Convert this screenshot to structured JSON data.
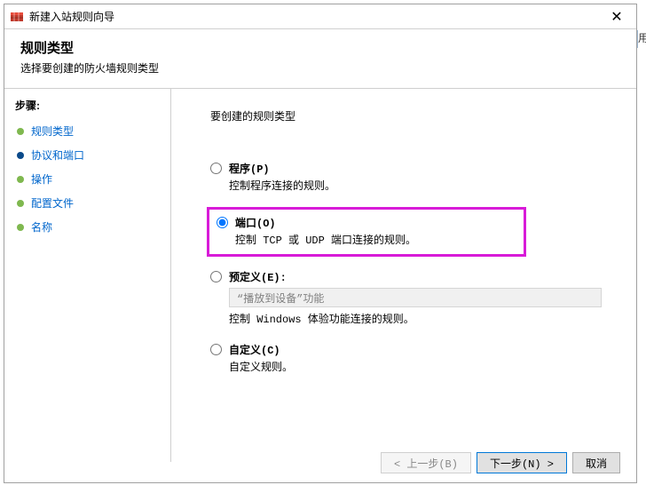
{
  "titlebar": {
    "title": "新建入站规则向导"
  },
  "header": {
    "title": "规则类型",
    "subtitle": "选择要创建的防火墙规则类型"
  },
  "sidebar": {
    "heading": "步骤:",
    "items": [
      {
        "label": "规则类型",
        "active": false,
        "link": true,
        "bullet": "green"
      },
      {
        "label": "协议和端口",
        "active": true,
        "link": true,
        "bullet": "blue"
      },
      {
        "label": "操作",
        "active": false,
        "link": true,
        "bullet": "green"
      },
      {
        "label": "配置文件",
        "active": false,
        "link": true,
        "bullet": "green"
      },
      {
        "label": "名称",
        "active": false,
        "link": true,
        "bullet": "green"
      }
    ]
  },
  "main": {
    "prompt": "要创建的规则类型",
    "options": {
      "program": {
        "label": "程序(P)",
        "desc": "控制程序连接的规则。"
      },
      "port": {
        "label": "端口(O)",
        "desc": "控制 TCP 或 UDP 端口连接的规则。"
      },
      "predefined": {
        "label": "预定义(E):",
        "desc": "控制 Windows 体验功能连接的规则。",
        "dropdown": "“播放到设备”功能"
      },
      "custom": {
        "label": "自定义(C)",
        "desc": "自定义规则。"
      }
    }
  },
  "buttons": {
    "back": "< 上一步(B)",
    "next": "下一步(N) >",
    "cancel": "取消"
  },
  "side_stub": "用"
}
